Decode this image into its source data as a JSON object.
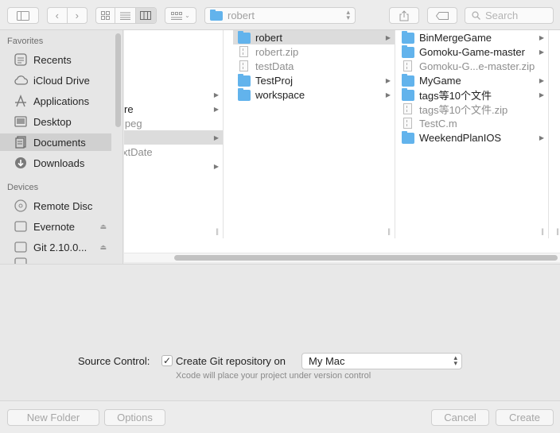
{
  "toolbar": {
    "path_title": "robert",
    "search_placeholder": "Search"
  },
  "sidebar": {
    "favorites_header": "Favorites",
    "favorites": [
      {
        "label": "Recents"
      },
      {
        "label": "iCloud Drive"
      },
      {
        "label": "Applications"
      },
      {
        "label": "Desktop"
      },
      {
        "label": "Documents"
      },
      {
        "label": "Downloads"
      }
    ],
    "devices_header": "Devices",
    "devices": [
      {
        "label": "Remote Disc"
      },
      {
        "label": "Evernote"
      },
      {
        "label": "Git 2.10.0..."
      }
    ]
  },
  "browser": {
    "col0_items": [
      "re",
      "jpeg",
      "xtDate"
    ],
    "col1_items": [
      {
        "label": "robert"
      },
      {
        "label": "robert.zip"
      },
      {
        "label": "testData"
      },
      {
        "label": "TestProj"
      },
      {
        "label": "workspace"
      }
    ],
    "col2_items": [
      {
        "label": "BinMergeGame"
      },
      {
        "label": "Gomoku-Game-master"
      },
      {
        "label": "Gomoku-G...e-master.zip"
      },
      {
        "label": "MyGame"
      },
      {
        "label": "tags等10个文件"
      },
      {
        "label": "tags等10个文件.zip"
      },
      {
        "label": "TestC.m"
      },
      {
        "label": "WeekendPlanIOS"
      }
    ]
  },
  "options": {
    "source_control_label": "Source Control:",
    "checkbox_label": "Create Git repository on",
    "checkbox_mark": "✓",
    "location_value": "My Mac",
    "hint": "Xcode will place your project under version control"
  },
  "buttons": {
    "new_folder": "New Folder",
    "options": "Options",
    "cancel": "Cancel",
    "create": "Create"
  }
}
